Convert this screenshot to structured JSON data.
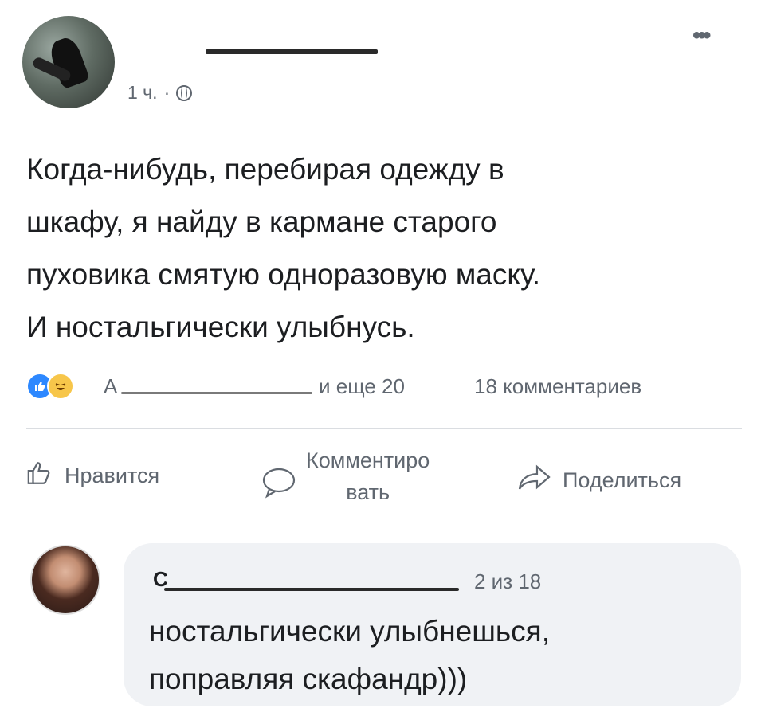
{
  "post": {
    "time": "1 ч.",
    "separator": "·",
    "privacy_icon": "globe-icon",
    "more_icon": "more-dots-icon",
    "more_label": "•••",
    "text_lines": [
      "Когда-нибудь, перебирая одежду в",
      "шкафу, я найду в кармане старого",
      "пуховика смятую одноразовую маску.",
      "И ностальгически улыбнусь."
    ]
  },
  "reactions": {
    "icons": [
      "like-reaction-icon",
      "haha-reaction-icon"
    ],
    "name_initial": "А",
    "others": "и еще 20",
    "comments_count": "18 комментариев"
  },
  "actions": {
    "like": "Нравится",
    "comment_line1": "Комментиро",
    "comment_line2": "вать",
    "share": "Поделиться"
  },
  "comment": {
    "author_initial": "С",
    "position": "2 из 18",
    "text_lines": [
      "ностальгически улыбнешься,",
      "поправляя скафандр)))"
    ]
  },
  "colors": {
    "text": "#1c1e21",
    "secondary": "#606770",
    "like_blue": "#2d88ff",
    "bubble_bg": "#f0f2f5"
  }
}
